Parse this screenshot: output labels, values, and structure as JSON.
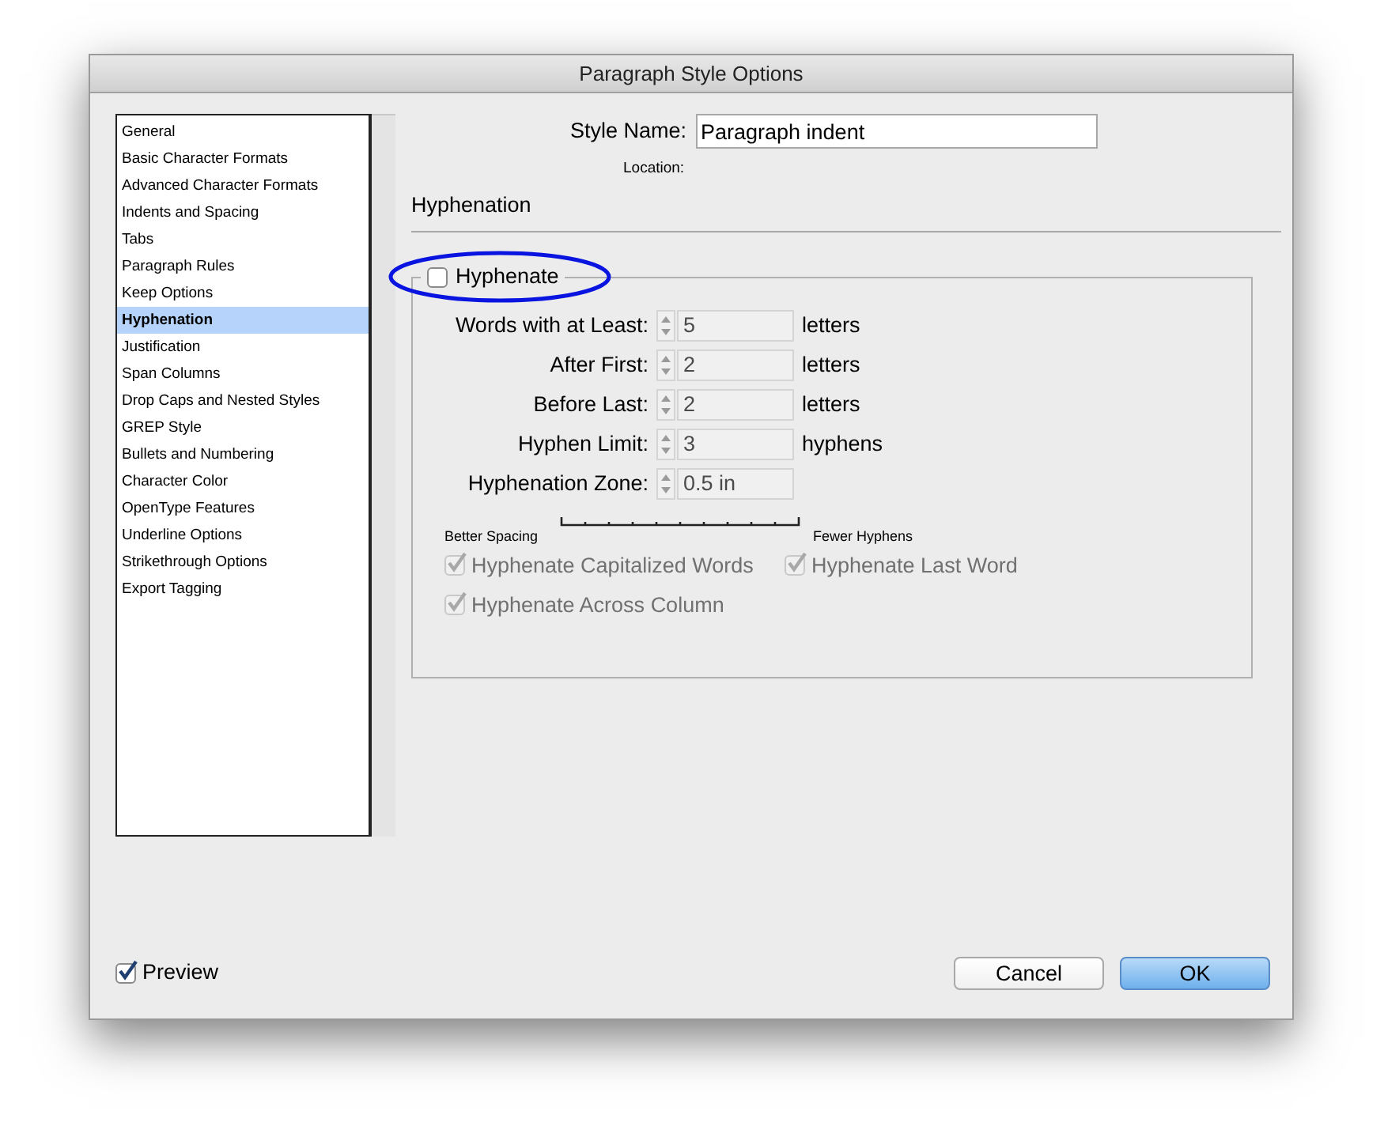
{
  "window": {
    "title": "Paragraph Style Options"
  },
  "sidebar": {
    "items": [
      {
        "label": "General",
        "selected": false
      },
      {
        "label": "Basic Character Formats",
        "selected": false
      },
      {
        "label": "Advanced Character Formats",
        "selected": false
      },
      {
        "label": "Indents and Spacing",
        "selected": false
      },
      {
        "label": "Tabs",
        "selected": false
      },
      {
        "label": "Paragraph Rules",
        "selected": false
      },
      {
        "label": "Keep Options",
        "selected": false
      },
      {
        "label": "Hyphenation",
        "selected": true
      },
      {
        "label": "Justification",
        "selected": false
      },
      {
        "label": "Span Columns",
        "selected": false
      },
      {
        "label": "Drop Caps and Nested Styles",
        "selected": false
      },
      {
        "label": "GREP Style",
        "selected": false
      },
      {
        "label": "Bullets and Numbering",
        "selected": false
      },
      {
        "label": "Character Color",
        "selected": false
      },
      {
        "label": "OpenType Features",
        "selected": false
      },
      {
        "label": "Underline Options",
        "selected": false
      },
      {
        "label": "Strikethrough Options",
        "selected": false
      },
      {
        "label": "Export Tagging",
        "selected": false
      }
    ]
  },
  "style_name": {
    "label": "Style Name:",
    "value": "Paragraph indent"
  },
  "location": {
    "label": "Location:"
  },
  "section_title": "Hyphenation",
  "hyphenate": {
    "label": "Hyphenate",
    "checked": false
  },
  "fields": [
    {
      "label": "Words with at Least:",
      "value": "5",
      "unit": "letters",
      "disabled": true
    },
    {
      "label": "After First:",
      "value": "2",
      "unit": "letters",
      "disabled": true
    },
    {
      "label": "Before Last:",
      "value": "2",
      "unit": "letters",
      "disabled": true
    },
    {
      "label": "Hyphen Limit:",
      "value": "3",
      "unit": "hyphens",
      "disabled": true
    },
    {
      "label": "Hyphenation Zone:",
      "value": "0.5 in",
      "disabled": true
    }
  ],
  "slider": {
    "left_label": "Better Spacing",
    "right_label": "Fewer Hyphens"
  },
  "options": [
    {
      "label": "Hyphenate Capitalized Words",
      "checked": true,
      "disabled": true
    },
    {
      "label": "Hyphenate Last Word",
      "checked": true,
      "disabled": true
    },
    {
      "label": "Hyphenate Across Column",
      "checked": true,
      "disabled": true
    }
  ],
  "preview": {
    "label": "Preview",
    "checked": true
  },
  "buttons": [
    {
      "label": "Cancel",
      "kind": "normal"
    },
    {
      "label": "OK",
      "kind": "default"
    }
  ]
}
